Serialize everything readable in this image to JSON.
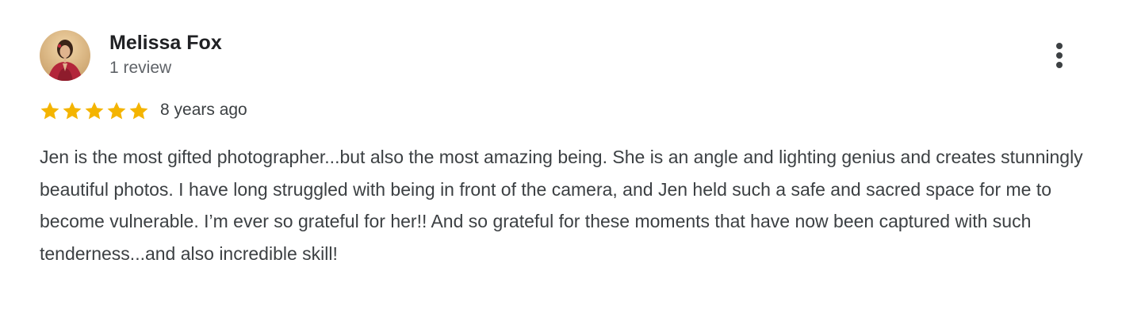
{
  "review": {
    "reviewer_name": "Melissa Fox",
    "review_count": "1 review",
    "rating": 5,
    "rating_max": 5,
    "date": "8 years ago",
    "text": "Jen is the most gifted photographer...but also the most amazing being. She is an angle and lighting genius and creates stunningly beautiful photos. I have long struggled with being in front of the camera, and Jen held such a safe and sacred space for me to become vulnerable. I’m ever so grateful for her!! And so grateful for these moments that have now been captured with such tenderness...and also incredible skill!"
  },
  "icons": {
    "avatar": "avatar-photo",
    "more": "more-vert-icon",
    "star": "star-icon"
  },
  "colors": {
    "star": "#f4b400",
    "name": "#202124",
    "secondary_text": "#5f6368",
    "body_text": "#3c4043",
    "background": "#ffffff"
  }
}
